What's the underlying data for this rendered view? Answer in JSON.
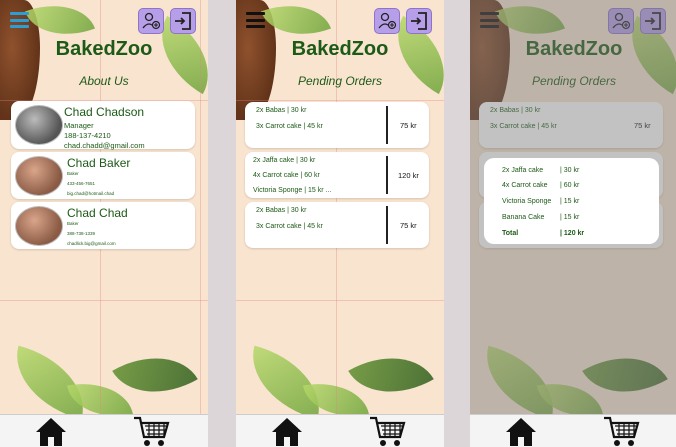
{
  "brand": "BakedZoo",
  "screens": {
    "about": {
      "subtitle": "About Us",
      "people": [
        {
          "name": "Chad Chadson",
          "role": "Manager",
          "phone": "188-137-4210",
          "email": "chad.chadd@gmail.com"
        },
        {
          "name": "Chad Baker",
          "role": "Baker",
          "phone": "433-456-7651",
          "email": "big.chad@hotmail.chad"
        },
        {
          "name": "Chad Chad",
          "role": "Baker",
          "phone": "388-738-1339",
          "email": "chadlick.big@gmail.com"
        }
      ]
    },
    "orders": {
      "subtitle": "Pending Orders",
      "orders": [
        {
          "items": [
            "2x Babas      | 30 kr",
            "3x Carrot cake | 45 kr"
          ],
          "total": "75 kr"
        },
        {
          "items": [
            "2x Jaffa cake      | 30 kr",
            "4x Carrot cake      | 60 kr",
            "Victoria Sponge | 15 kr   ..."
          ],
          "total": "120 kr"
        },
        {
          "items": [
            "2x Babas      | 30 kr",
            "3x Carrot cake | 45 kr"
          ],
          "total": "75 kr"
        }
      ]
    },
    "detail": {
      "subtitle": "Pending Orders",
      "popup_lines": [
        {
          "name": "2x Jaffa cake",
          "price": "| 30 kr"
        },
        {
          "name": "4x Carrot cake",
          "price": "| 60 kr"
        },
        {
          "name": "Victoria Sponge",
          "price": "| 15 kr"
        },
        {
          "name": "Banana Cake",
          "price": "| 15 kr"
        },
        {
          "name": "Total",
          "price": "| 120 kr"
        }
      ],
      "background_order_1": {
        "items": [
          "2x Babas      | 30 kr",
          "3x Carrot cake | 45 kr"
        ],
        "total": "75 kr"
      }
    }
  },
  "icons": {
    "menu": "hamburger-menu-icon",
    "profile": "add-user-icon",
    "logout": "logout-icon",
    "home": "home-icon",
    "cart": "shopping-cart-icon"
  },
  "colors": {
    "brand_green": "#1d5a17",
    "header_button": "#b79ee8",
    "background": "#f8e4cf"
  }
}
